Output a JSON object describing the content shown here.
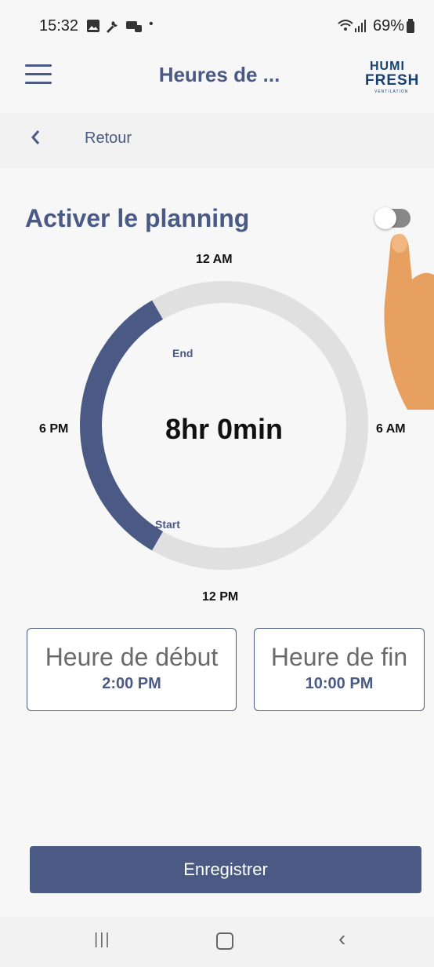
{
  "status_bar": {
    "time": "15:32",
    "dot": "•",
    "battery": "69%",
    "icons": [
      "gallery-icon",
      "wrench-icon",
      "notification-icon",
      "wifi-icon",
      "signal-icon",
      "battery-icon"
    ]
  },
  "app_bar": {
    "title": "Heures de ...",
    "logo_line1": "HUMI",
    "logo_line2": "FRESH",
    "logo_line3": "VENTILATION"
  },
  "back": {
    "label": "Retour"
  },
  "schedule": {
    "heading": "Activer le planning",
    "toggle_on": false,
    "clock_labels": {
      "top": "12 AM",
      "right": "6 AM",
      "left": "6 PM",
      "bottom": "12 PM"
    },
    "end_label": "End",
    "start_label": "Start",
    "duration": "8hr 0min",
    "start_time": "2:00 PM",
    "end_time": "10:00 PM",
    "start_heading": "Heure de début",
    "end_heading": "Heure de fin"
  },
  "save_label": "Enregistrer",
  "colors": {
    "primary": "#4a5a85",
    "ring_track": "#e0e0e0",
    "background": "#f7f7f7"
  }
}
